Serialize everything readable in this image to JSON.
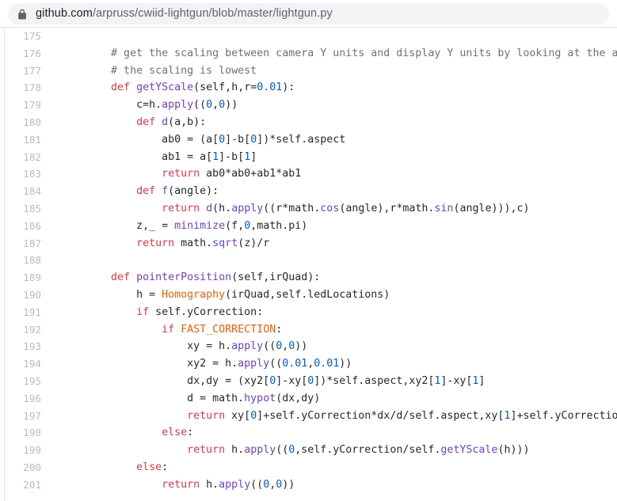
{
  "browser": {
    "lock_icon": "lock-icon",
    "url_host": "github.com",
    "url_path": "/arpruss/cwiid-lightgun/blob/master/lightgun.py",
    "url_full": "github.com/arpruss/cwiid-lightgun/blob/master/lightgun.py"
  },
  "code": {
    "language": "python",
    "file_name": "lightgun.py",
    "first_line_number": 175,
    "last_line_number": 201,
    "lines": [
      {
        "n": "175",
        "tokens": []
      },
      {
        "n": "176",
        "tokens": [
          {
            "t": "        ",
            "c": "t-txt"
          },
          {
            "t": "# get the scaling between camera Y units and display Y units by looking at the angle at which",
            "c": "t-cmt"
          }
        ]
      },
      {
        "n": "177",
        "tokens": [
          {
            "t": "        ",
            "c": "t-txt"
          },
          {
            "t": "# the scaling is lowest",
            "c": "t-cmt"
          }
        ]
      },
      {
        "n": "178",
        "tokens": [
          {
            "t": "        ",
            "c": "t-txt"
          },
          {
            "t": "def",
            "c": "t-kw"
          },
          {
            "t": " ",
            "c": "t-txt"
          },
          {
            "t": "getYScale",
            "c": "t-fn"
          },
          {
            "t": "(self,h,r=",
            "c": "t-txt"
          },
          {
            "t": "0.01",
            "c": "t-num"
          },
          {
            "t": "):",
            "c": "t-txt"
          }
        ]
      },
      {
        "n": "179",
        "tokens": [
          {
            "t": "            c=h.",
            "c": "t-txt"
          },
          {
            "t": "apply",
            "c": "t-fn"
          },
          {
            "t": "((",
            "c": "t-txt"
          },
          {
            "t": "0",
            "c": "t-num"
          },
          {
            "t": ",",
            "c": "t-txt"
          },
          {
            "t": "0",
            "c": "t-num"
          },
          {
            "t": "))",
            "c": "t-txt"
          }
        ]
      },
      {
        "n": "180",
        "tokens": [
          {
            "t": "            ",
            "c": "t-txt"
          },
          {
            "t": "def",
            "c": "t-kw"
          },
          {
            "t": " ",
            "c": "t-txt"
          },
          {
            "t": "d",
            "c": "t-fn"
          },
          {
            "t": "(a,b):",
            "c": "t-txt"
          }
        ]
      },
      {
        "n": "181",
        "tokens": [
          {
            "t": "                ab0 = (a[",
            "c": "t-txt"
          },
          {
            "t": "0",
            "c": "t-num"
          },
          {
            "t": "]-b[",
            "c": "t-txt"
          },
          {
            "t": "0",
            "c": "t-num"
          },
          {
            "t": "])*self.aspect",
            "c": "t-txt"
          }
        ]
      },
      {
        "n": "182",
        "tokens": [
          {
            "t": "                ab1 = a[",
            "c": "t-txt"
          },
          {
            "t": "1",
            "c": "t-num"
          },
          {
            "t": "]-b[",
            "c": "t-txt"
          },
          {
            "t": "1",
            "c": "t-num"
          },
          {
            "t": "]",
            "c": "t-txt"
          }
        ]
      },
      {
        "n": "183",
        "tokens": [
          {
            "t": "                ",
            "c": "t-txt"
          },
          {
            "t": "return",
            "c": "t-kw"
          },
          {
            "t": " ab0*ab0+ab1*ab1",
            "c": "t-txt"
          }
        ]
      },
      {
        "n": "184",
        "tokens": [
          {
            "t": "            ",
            "c": "t-txt"
          },
          {
            "t": "def",
            "c": "t-kw"
          },
          {
            "t": " ",
            "c": "t-txt"
          },
          {
            "t": "f",
            "c": "t-fn"
          },
          {
            "t": "(angle):",
            "c": "t-txt"
          }
        ]
      },
      {
        "n": "185",
        "tokens": [
          {
            "t": "                ",
            "c": "t-txt"
          },
          {
            "t": "return",
            "c": "t-kw"
          },
          {
            "t": " ",
            "c": "t-txt"
          },
          {
            "t": "d",
            "c": "t-fn"
          },
          {
            "t": "(h.",
            "c": "t-txt"
          },
          {
            "t": "apply",
            "c": "t-fn"
          },
          {
            "t": "((r*math.",
            "c": "t-txt"
          },
          {
            "t": "cos",
            "c": "t-fn"
          },
          {
            "t": "(angle),r*math.",
            "c": "t-txt"
          },
          {
            "t": "sin",
            "c": "t-fn"
          },
          {
            "t": "(angle))),c)",
            "c": "t-txt"
          }
        ]
      },
      {
        "n": "186",
        "tokens": [
          {
            "t": "            z,_ = ",
            "c": "t-txt"
          },
          {
            "t": "minimize",
            "c": "t-fn"
          },
          {
            "t": "(f,",
            "c": "t-txt"
          },
          {
            "t": "0",
            "c": "t-num"
          },
          {
            "t": ",math.pi)",
            "c": "t-txt"
          }
        ]
      },
      {
        "n": "187",
        "tokens": [
          {
            "t": "            ",
            "c": "t-txt"
          },
          {
            "t": "return",
            "c": "t-kw"
          },
          {
            "t": " math.",
            "c": "t-txt"
          },
          {
            "t": "sqrt",
            "c": "t-fn"
          },
          {
            "t": "(z)/r",
            "c": "t-txt"
          }
        ]
      },
      {
        "n": "188",
        "tokens": []
      },
      {
        "n": "189",
        "tokens": [
          {
            "t": "        ",
            "c": "t-txt"
          },
          {
            "t": "def",
            "c": "t-kw"
          },
          {
            "t": " ",
            "c": "t-txt"
          },
          {
            "t": "pointerPosition",
            "c": "t-fn"
          },
          {
            "t": "(self,irQuad):",
            "c": "t-txt"
          }
        ]
      },
      {
        "n": "190",
        "tokens": [
          {
            "t": "            h = ",
            "c": "t-txt"
          },
          {
            "t": "Homography",
            "c": "t-cnst"
          },
          {
            "t": "(irQuad,self.ledLocations)",
            "c": "t-txt"
          }
        ]
      },
      {
        "n": "191",
        "tokens": [
          {
            "t": "            ",
            "c": "t-txt"
          },
          {
            "t": "if",
            "c": "t-kw"
          },
          {
            "t": " self.yCorrection:",
            "c": "t-txt"
          }
        ]
      },
      {
        "n": "192",
        "tokens": [
          {
            "t": "                ",
            "c": "t-txt"
          },
          {
            "t": "if",
            "c": "t-kw"
          },
          {
            "t": " ",
            "c": "t-txt"
          },
          {
            "t": "FAST_CORRECTION",
            "c": "t-cnst"
          },
          {
            "t": ":",
            "c": "t-txt"
          }
        ]
      },
      {
        "n": "193",
        "tokens": [
          {
            "t": "                    xy = h.",
            "c": "t-txt"
          },
          {
            "t": "apply",
            "c": "t-fn"
          },
          {
            "t": "((",
            "c": "t-txt"
          },
          {
            "t": "0",
            "c": "t-num"
          },
          {
            "t": ",",
            "c": "t-txt"
          },
          {
            "t": "0",
            "c": "t-num"
          },
          {
            "t": "))",
            "c": "t-txt"
          }
        ]
      },
      {
        "n": "194",
        "tokens": [
          {
            "t": "                    xy2 = h.",
            "c": "t-txt"
          },
          {
            "t": "apply",
            "c": "t-fn"
          },
          {
            "t": "((",
            "c": "t-txt"
          },
          {
            "t": "0.01",
            "c": "t-num"
          },
          {
            "t": ",",
            "c": "t-txt"
          },
          {
            "t": "0.01",
            "c": "t-num"
          },
          {
            "t": "))",
            "c": "t-txt"
          }
        ]
      },
      {
        "n": "195",
        "tokens": [
          {
            "t": "                    dx,dy = (xy2[",
            "c": "t-txt"
          },
          {
            "t": "0",
            "c": "t-num"
          },
          {
            "t": "]-xy[",
            "c": "t-txt"
          },
          {
            "t": "0",
            "c": "t-num"
          },
          {
            "t": "])*self.aspect,xy2[",
            "c": "t-txt"
          },
          {
            "t": "1",
            "c": "t-num"
          },
          {
            "t": "]-xy[",
            "c": "t-txt"
          },
          {
            "t": "1",
            "c": "t-num"
          },
          {
            "t": "]",
            "c": "t-txt"
          }
        ]
      },
      {
        "n": "196",
        "tokens": [
          {
            "t": "                    d = math.",
            "c": "t-txt"
          },
          {
            "t": "hypot",
            "c": "t-fn"
          },
          {
            "t": "(dx,dy)",
            "c": "t-txt"
          }
        ]
      },
      {
        "n": "197",
        "tokens": [
          {
            "t": "                    ",
            "c": "t-txt"
          },
          {
            "t": "return",
            "c": "t-kw"
          },
          {
            "t": " xy[",
            "c": "t-txt"
          },
          {
            "t": "0",
            "c": "t-num"
          },
          {
            "t": "]+self.yCorrection*dx/d/self.aspect,xy[",
            "c": "t-txt"
          },
          {
            "t": "1",
            "c": "t-num"
          },
          {
            "t": "]+self.yCorrection*dy/d",
            "c": "t-txt"
          }
        ]
      },
      {
        "n": "198",
        "tokens": [
          {
            "t": "                ",
            "c": "t-txt"
          },
          {
            "t": "else",
            "c": "t-kw"
          },
          {
            "t": ":",
            "c": "t-txt"
          }
        ]
      },
      {
        "n": "199",
        "tokens": [
          {
            "t": "                    ",
            "c": "t-txt"
          },
          {
            "t": "return",
            "c": "t-kw"
          },
          {
            "t": " h.",
            "c": "t-txt"
          },
          {
            "t": "apply",
            "c": "t-fn"
          },
          {
            "t": "((",
            "c": "t-txt"
          },
          {
            "t": "0",
            "c": "t-num"
          },
          {
            "t": ",self.yCorrection/self.",
            "c": "t-txt"
          },
          {
            "t": "getYScale",
            "c": "t-fn"
          },
          {
            "t": "(h)))",
            "c": "t-txt"
          }
        ]
      },
      {
        "n": "200",
        "tokens": [
          {
            "t": "            ",
            "c": "t-txt"
          },
          {
            "t": "else",
            "c": "t-kw"
          },
          {
            "t": ":",
            "c": "t-txt"
          }
        ]
      },
      {
        "n": "201",
        "tokens": [
          {
            "t": "                ",
            "c": "t-txt"
          },
          {
            "t": "return",
            "c": "t-kw"
          },
          {
            "t": " h.",
            "c": "t-txt"
          },
          {
            "t": "apply",
            "c": "t-fn"
          },
          {
            "t": "((",
            "c": "t-txt"
          },
          {
            "t": "0",
            "c": "t-num"
          },
          {
            "t": ",",
            "c": "t-txt"
          },
          {
            "t": "0",
            "c": "t-num"
          },
          {
            "t": "))",
            "c": "t-txt"
          }
        ]
      }
    ]
  },
  "colors": {
    "keyword": "#d73a49",
    "function": "#6f42c1",
    "number": "#005cc5",
    "constant": "#e36209",
    "comment": "#6a737d",
    "text": "#24292e",
    "line_number": "#babbbd",
    "omnibox_bg": "#f1f3f4",
    "page_bg": "#ffffff"
  }
}
